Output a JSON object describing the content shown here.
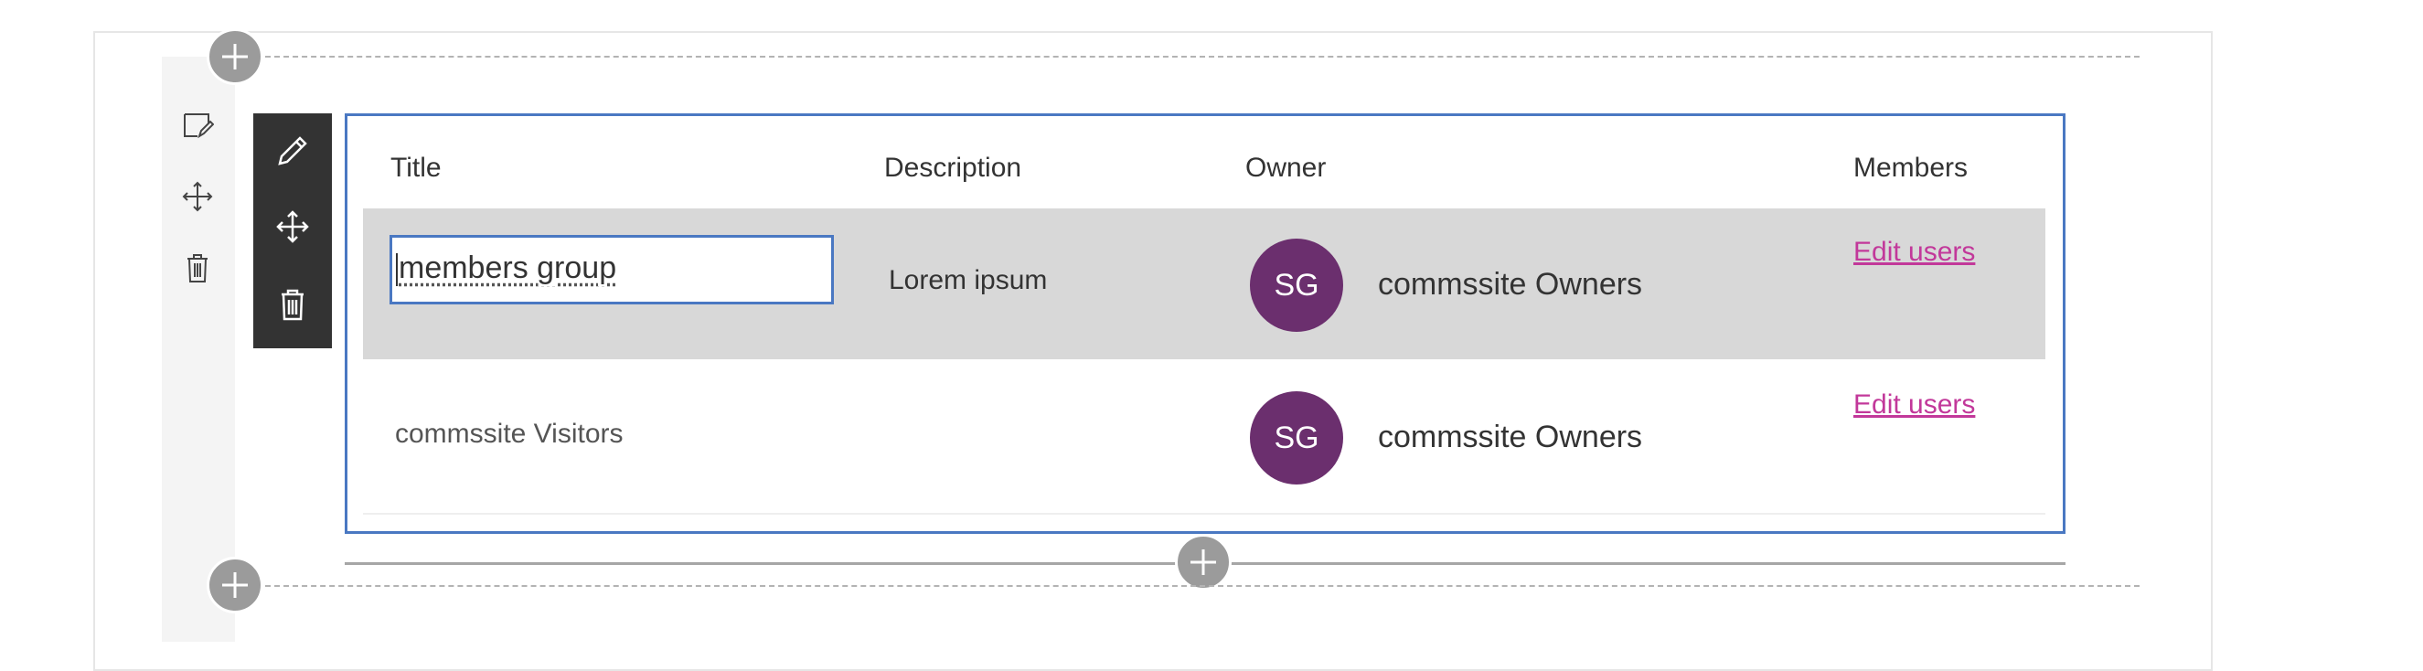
{
  "table": {
    "headers": {
      "title": "Title",
      "description": "Description",
      "owner": "Owner",
      "members": "Members"
    },
    "rows": [
      {
        "title": "members group",
        "description": "Lorem ipsum",
        "owner_initials": "SG",
        "owner_name": "commssite Owners",
        "members_link": "Edit users"
      },
      {
        "title": "commssite Visitors",
        "description": "",
        "owner_initials": "SG",
        "owner_name": "commssite Owners",
        "members_link": "Edit users"
      }
    ]
  },
  "icons": {
    "section_rail": [
      "edit-section-icon",
      "move-icon",
      "delete-icon"
    ],
    "webpart_toolbar": [
      "pencil-icon",
      "move-icon",
      "delete-icon"
    ],
    "add": "plus-icon"
  },
  "colors": {
    "accent_border": "#4a78c2",
    "avatar_bg": "#6b2f6e",
    "link": "#c2389a",
    "toolbar_bg": "#333333",
    "selected_row_bg": "#d8d8d8"
  }
}
